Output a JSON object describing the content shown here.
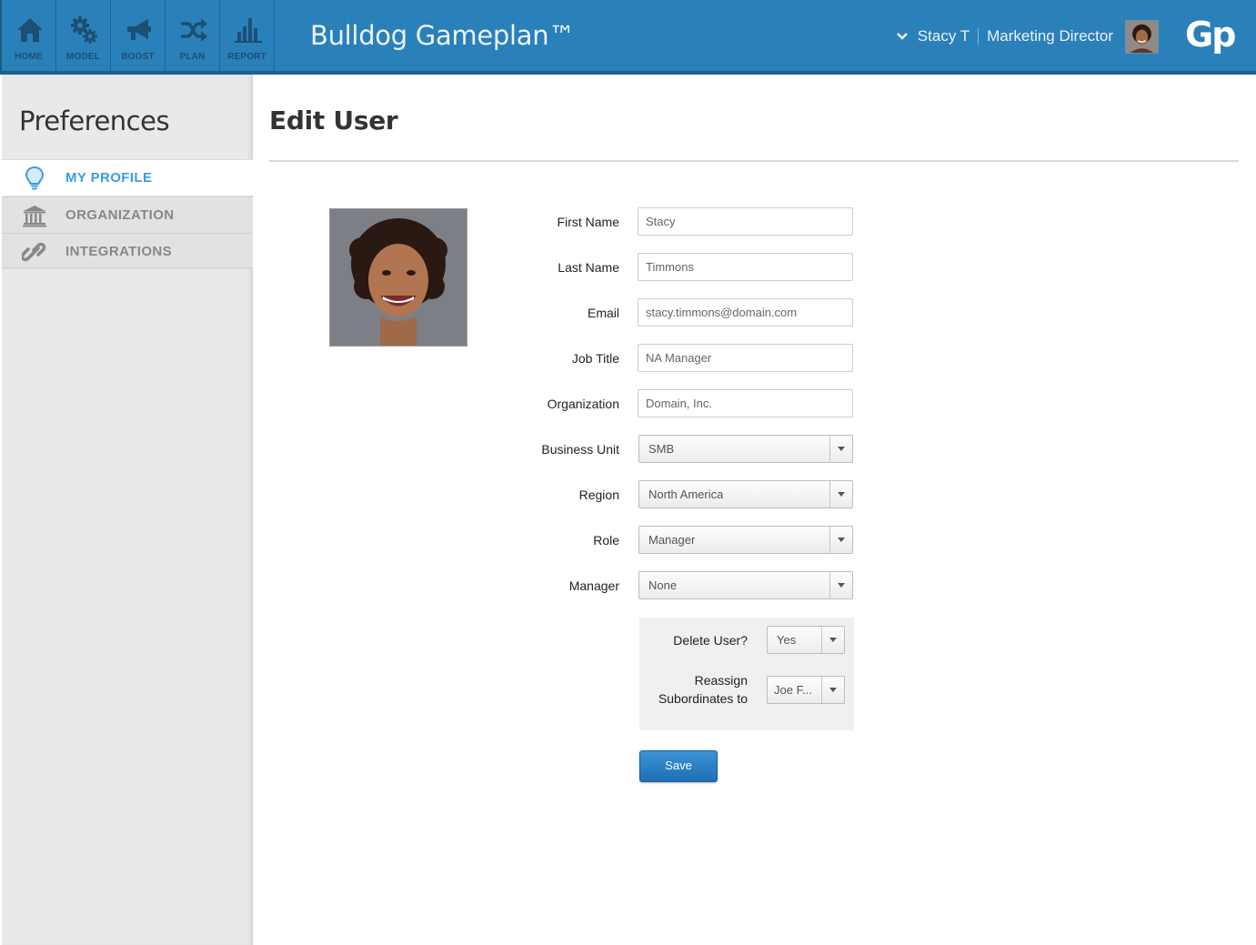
{
  "header": {
    "app_title": "Bulldog Gameplan™",
    "logo_text": "Gp",
    "nav": [
      {
        "label": "HOME",
        "icon": "home-icon"
      },
      {
        "label": "MODEL",
        "icon": "gears-icon"
      },
      {
        "label": "BOOST",
        "icon": "megaphone-icon"
      },
      {
        "label": "PLAN",
        "icon": "shuffle-icon"
      },
      {
        "label": "REPORT",
        "icon": "bar-chart-icon"
      }
    ],
    "user_name": "Stacy T",
    "user_title": "Marketing Director",
    "colors": {
      "bar": "#2a80b9",
      "icon": "#1c4f75"
    }
  },
  "sidebar": {
    "title": "Preferences",
    "items": [
      {
        "label": "MY PROFILE",
        "icon": "lightbulb-icon",
        "active": true
      },
      {
        "label": "ORGANIZATION",
        "icon": "bank-icon",
        "active": false
      },
      {
        "label": "INTEGRATIONS",
        "icon": "link-icon",
        "active": false
      }
    ],
    "active_color": "#3a9de0"
  },
  "main": {
    "title": "Edit User",
    "fields": {
      "first_name": {
        "label": "First Name",
        "value": "Stacy"
      },
      "last_name": {
        "label": "Last Name",
        "value": "Timmons"
      },
      "email": {
        "label": "Email",
        "value": "stacy.timmons@domain.com"
      },
      "job_title": {
        "label": "Job Title",
        "value": "NA Manager"
      },
      "organization": {
        "label": "Organization",
        "value": "Domain, Inc."
      },
      "business_unit": {
        "label": "Business Unit",
        "value": "SMB"
      },
      "region": {
        "label": "Region",
        "value": "North America"
      },
      "role": {
        "label": "Role",
        "value": "Manager"
      },
      "manager": {
        "label": "Manager",
        "value": "None"
      }
    },
    "delete_panel": {
      "delete_label": "Delete User?",
      "delete_value": "Yes",
      "reassign_label_line1": "Reassign",
      "reassign_label_line2": "Subordinates to",
      "reassign_value": "Joe F..."
    },
    "save_label": "Save"
  }
}
